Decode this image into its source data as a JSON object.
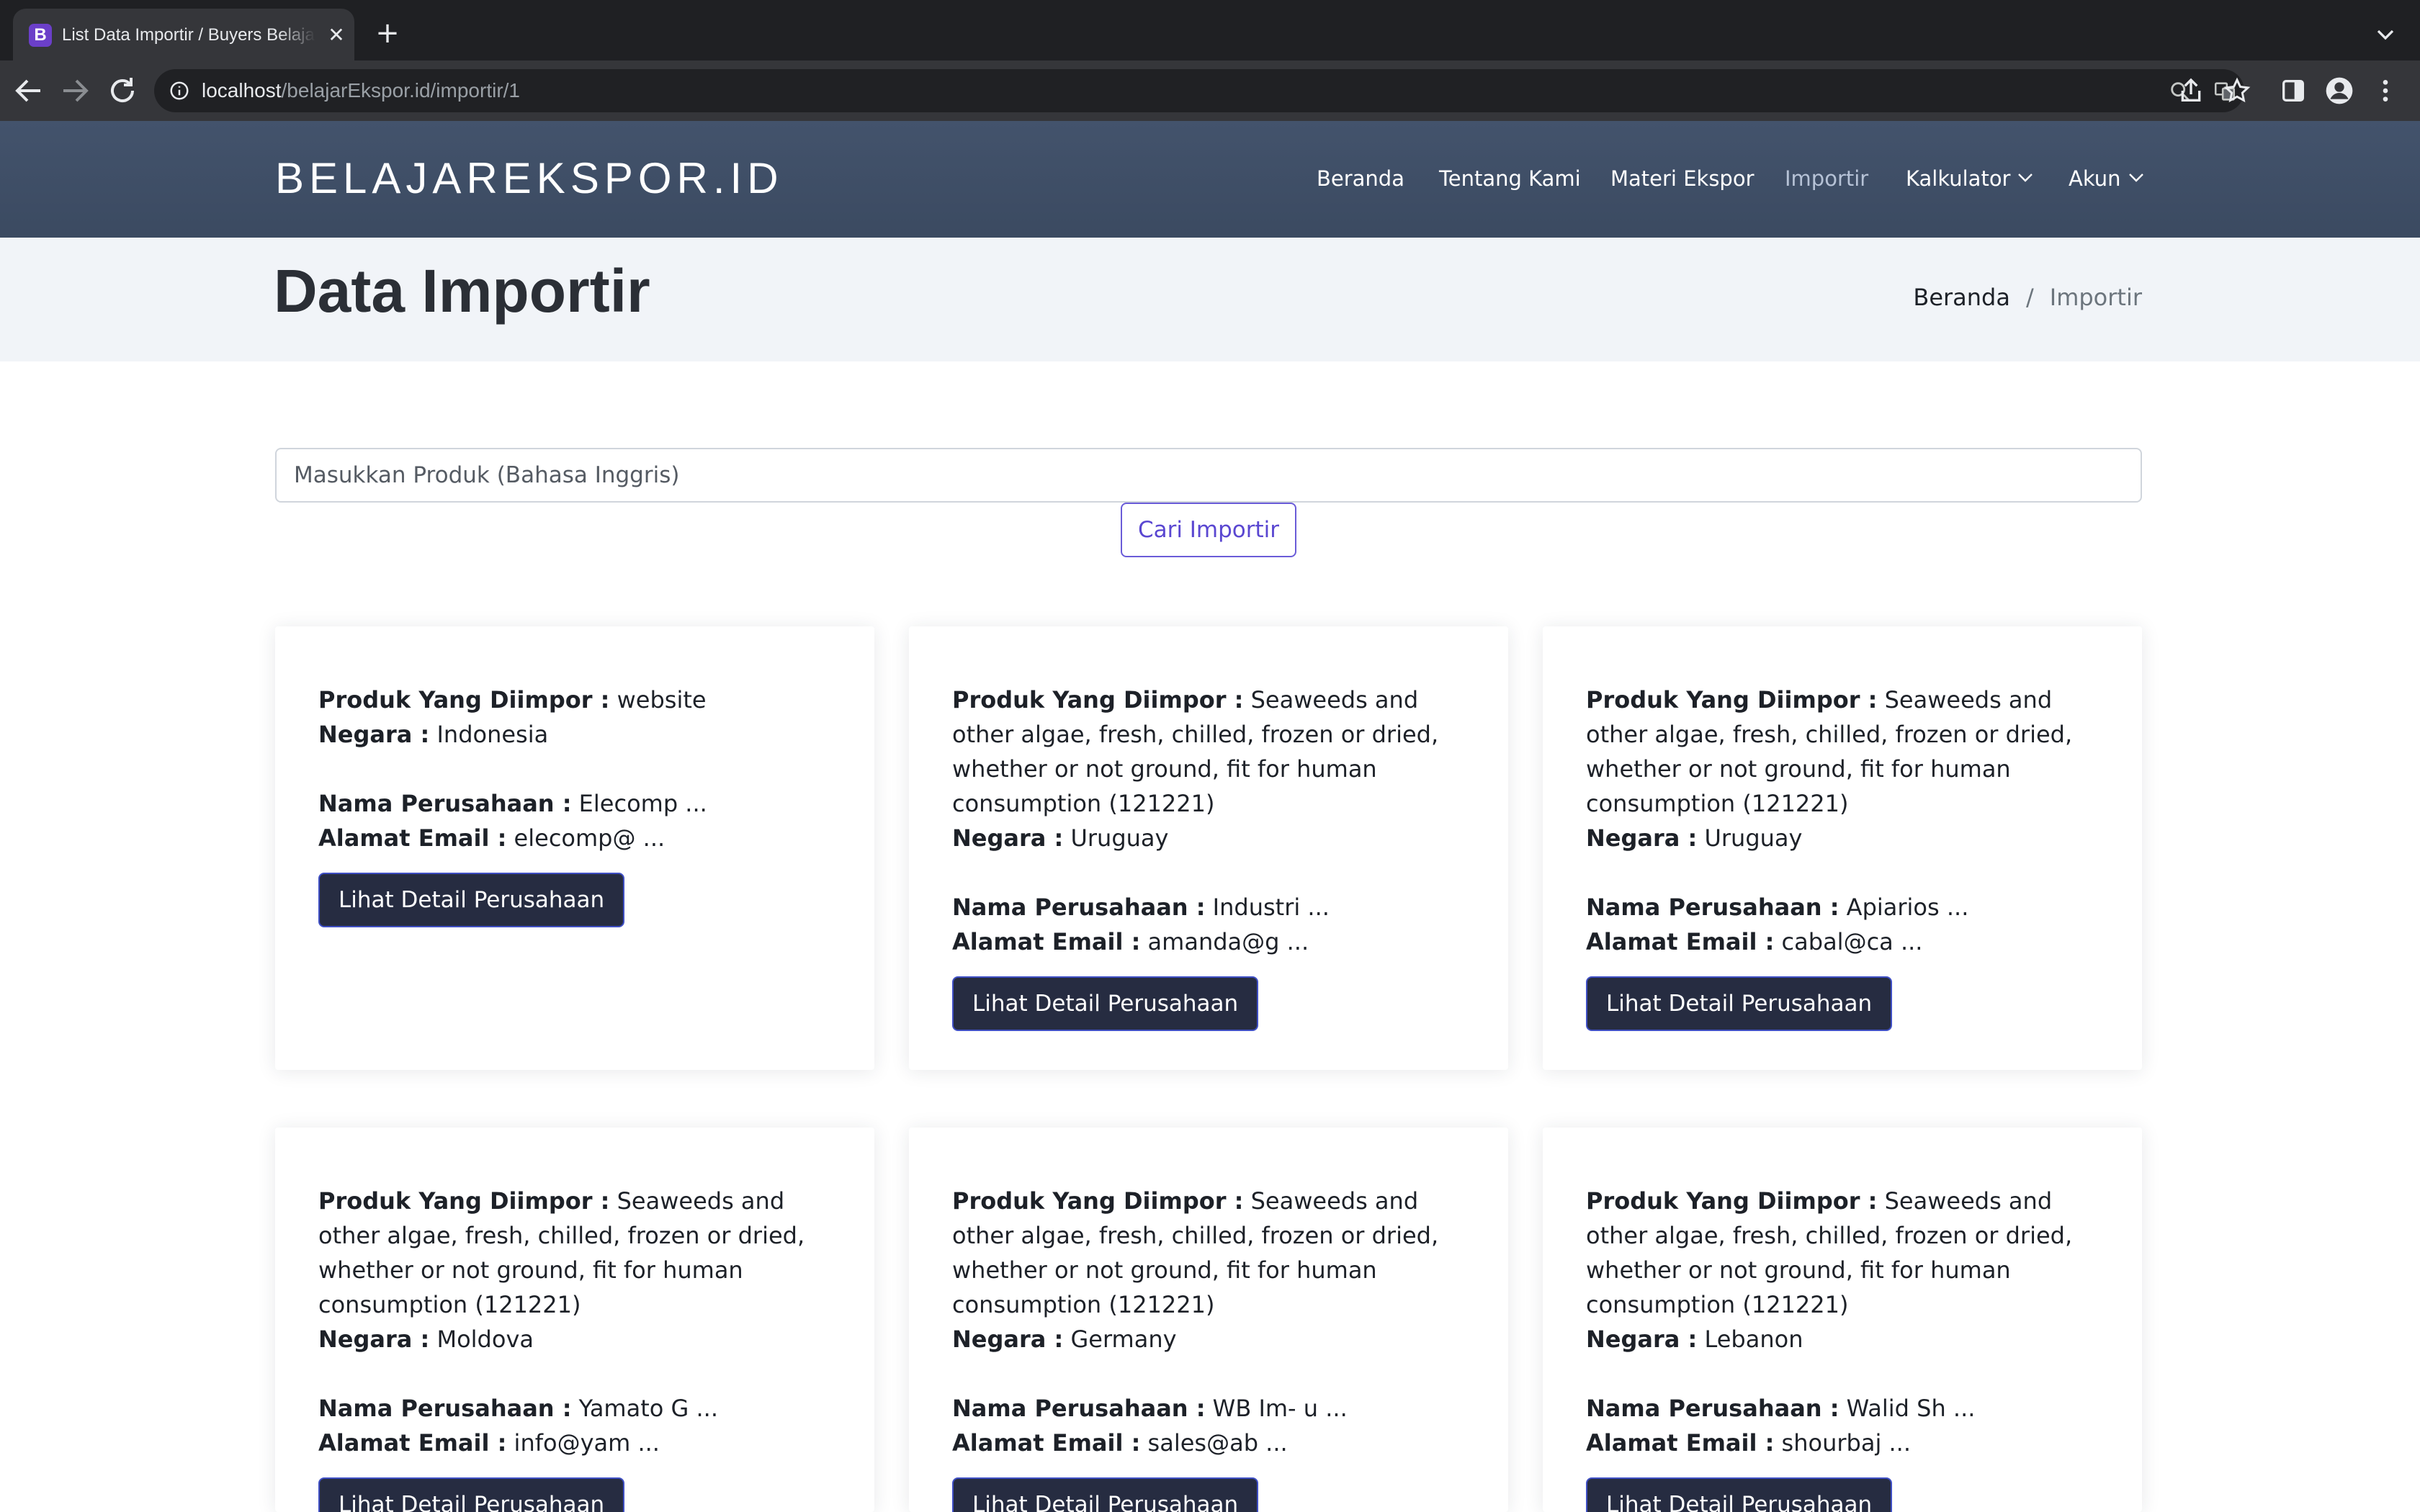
{
  "browser": {
    "tab_title": "List Data Importir / Buyers Belajar Ekspor",
    "favicon_letter": "B",
    "url_host": "localhost",
    "url_path": "/belajarEkspor.id/importir/1"
  },
  "navbar": {
    "brand": "BELAJAREKSPOR.ID",
    "links": [
      {
        "label": "Beranda"
      },
      {
        "label": "Tentang Kami"
      },
      {
        "label": "Materi Ekspor"
      },
      {
        "label": "Importir"
      },
      {
        "label": "Kalkulator"
      },
      {
        "label": "Akun"
      }
    ],
    "active_color": "#b6c2d6"
  },
  "header": {
    "title": "Data Importir",
    "breadcrumb": [
      "Beranda",
      "Importir"
    ]
  },
  "search": {
    "placeholder": "Masukkan Produk (Bahasa Inggris)",
    "button_label": "Cari Importir"
  },
  "labels": {
    "product": "Produk Yang Diimpor :",
    "country": "Negara :",
    "company": "Nama Perusahaan :",
    "email": "Alamat Email :",
    "detail_button": "Lihat Detail Perusahaan"
  },
  "cards": [
    {
      "product": "website",
      "country": "Indonesia",
      "company": "Elecomp ...",
      "email": "elecomp@ ..."
    },
    {
      "product": "Seaweeds and other algae, fresh, chilled, frozen or dried, whether or not ground, fit for human consumption (121221)",
      "country": "Uruguay",
      "company": "Industri ...",
      "email": "amanda@g ..."
    },
    {
      "product": "Seaweeds and other algae, fresh, chilled, frozen or dried, whether or not ground, fit for human consumption (121221)",
      "country": "Uruguay",
      "company": "Apiarios ...",
      "email": "cabal@ca ..."
    },
    {
      "product": "Seaweeds and other algae, fresh, chilled, frozen or dried, whether or not ground, fit for human consumption (121221)",
      "country": "Moldova",
      "company": "Yamato G ...",
      "email": "info@yam ..."
    },
    {
      "product": "Seaweeds and other algae, fresh, chilled, frozen or dried, whether or not ground, fit for human consumption (121221)",
      "country": "Germany",
      "company": "WB Im- u ...",
      "email": "sales@ab ..."
    },
    {
      "product": "Seaweeds and other algae, fresh, chilled, frozen or dried, whether or not ground, fit for human consumption (121221)",
      "country": "Lebanon",
      "company": "Walid Sh ...",
      "email": "shourbaj ..."
    }
  ],
  "colors": {
    "navbar_bg": "#3f4e66",
    "header_bg": "#f1f4f8",
    "detail_button_bg": "#262c41",
    "search_button_accent": "#5a47d1"
  }
}
